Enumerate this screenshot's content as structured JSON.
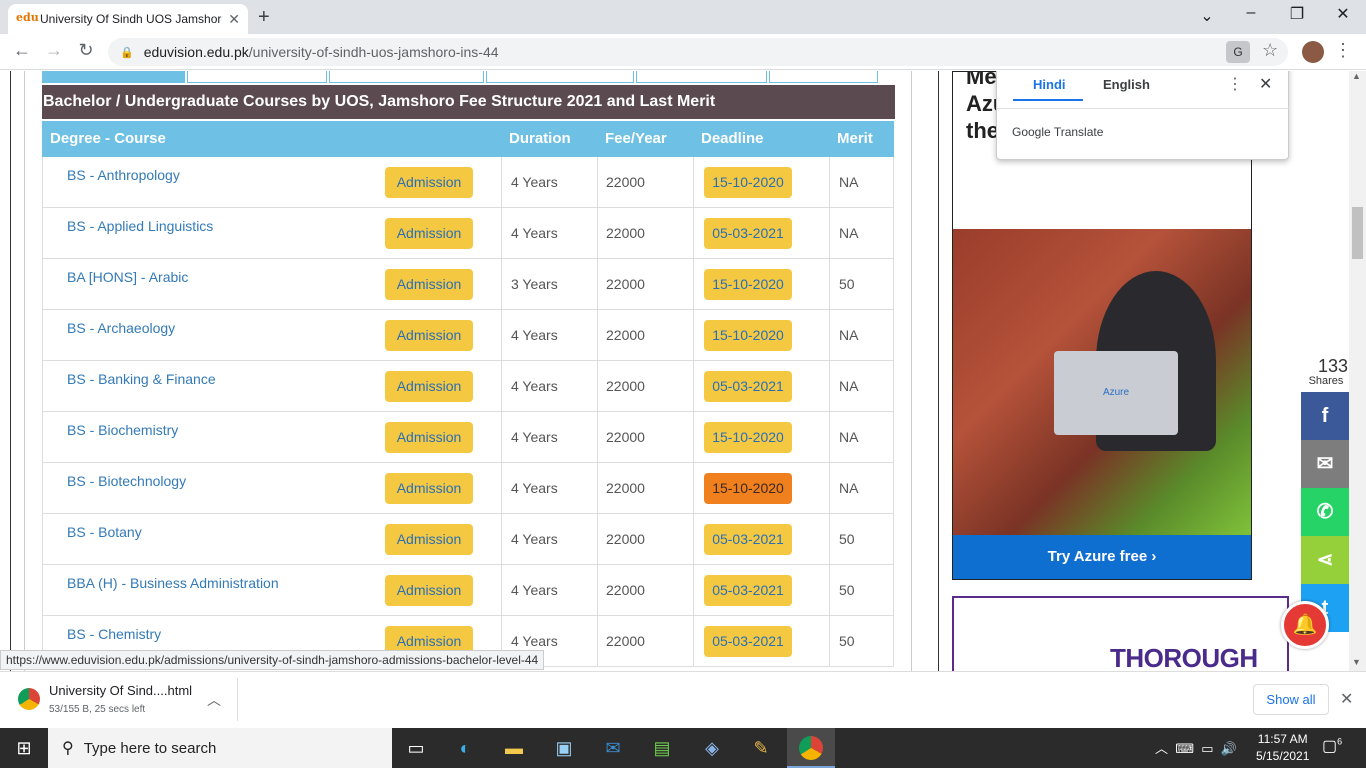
{
  "browser": {
    "tab_title": "University Of Sindh UOS Jamshoro",
    "tab_favicon": "edu",
    "new_tab": "+",
    "url_domain": "eduvision.edu.pk",
    "url_path": "/university-of-sindh-uos-jamshoro-ins-44"
  },
  "translate": {
    "lang_active": "Hindi",
    "lang_other": "English",
    "brand": "Google Translate"
  },
  "banner": "Bachelor / Undergraduate Courses by UOS, Jamshoro Fee Structure 2021 and Last Merit",
  "table": {
    "headers": {
      "course": "Degree - Course",
      "duration": "Duration",
      "fee": "Fee/Year",
      "deadline": "Deadline",
      "merit": "Merit"
    },
    "rows": [
      {
        "course": "BS - Anthropology",
        "admission": "Admission",
        "duration": "4 Years",
        "fee": "22000",
        "deadline": "15-10-2020",
        "merit": "NA"
      },
      {
        "course": "BS - Applied Linguistics",
        "admission": "Admission",
        "duration": "4 Years",
        "fee": "22000",
        "deadline": "05-03-2021",
        "merit": "NA"
      },
      {
        "course": "BA [HONS] - Arabic",
        "admission": "Admission",
        "duration": "3 Years",
        "fee": "22000",
        "deadline": "15-10-2020",
        "merit": "50"
      },
      {
        "course": "BS - Archaeology",
        "admission": "Admission",
        "duration": "4 Years",
        "fee": "22000",
        "deadline": "15-10-2020",
        "merit": "NA"
      },
      {
        "course": "BS - Banking & Finance",
        "admission": "Admission",
        "duration": "4 Years",
        "fee": "22000",
        "deadline": "05-03-2021",
        "merit": "NA"
      },
      {
        "course": "BS - Biochemistry",
        "admission": "Admission",
        "duration": "4 Years",
        "fee": "22000",
        "deadline": "15-10-2020",
        "merit": "NA"
      },
      {
        "course": "BS - Biotechnology",
        "admission": "Admission",
        "duration": "4 Years",
        "fee": "22000",
        "deadline": "15-10-2020",
        "merit": "NA",
        "highlight": true
      },
      {
        "course": "BS - Botany",
        "admission": "Admission",
        "duration": "4 Years",
        "fee": "22000",
        "deadline": "05-03-2021",
        "merit": "50"
      },
      {
        "course": "BBA (H) - Business Administration",
        "admission": "Admission",
        "duration": "4 Years",
        "fee": "22000",
        "deadline": "05-03-2021",
        "merit": "50"
      },
      {
        "course": "BS - Chemistry",
        "admission": "Admission",
        "duration": "4 Years",
        "fee": "22000",
        "deadline": "05-03-2021",
        "merit": "50"
      }
    ]
  },
  "ad": {
    "text_lines": [
      "Me",
      "Azu",
      "the"
    ],
    "laptop_label": "Azure",
    "cta": "Try Azure free  ›",
    "ad2_text": "THOROUGH"
  },
  "share": {
    "count": "133",
    "label": "Shares",
    "colors": {
      "facebook": "#3b5998",
      "email": "#7d7d7d",
      "whatsapp": "#25d366",
      "share": "#95d03a",
      "twitter": "#1da1f2"
    }
  },
  "status_url": "https://www.eduvision.edu.pk/admissions/university-of-sindh-jamshoro-admissions-bachelor-level-44",
  "download": {
    "filename": "University Of Sind....html",
    "status": "53/155 B, 25 secs left",
    "show_all": "Show all"
  },
  "taskbar": {
    "search_placeholder": "Type here to search",
    "time": "11:57 AM",
    "date": "5/15/2021",
    "notifications": "6"
  }
}
